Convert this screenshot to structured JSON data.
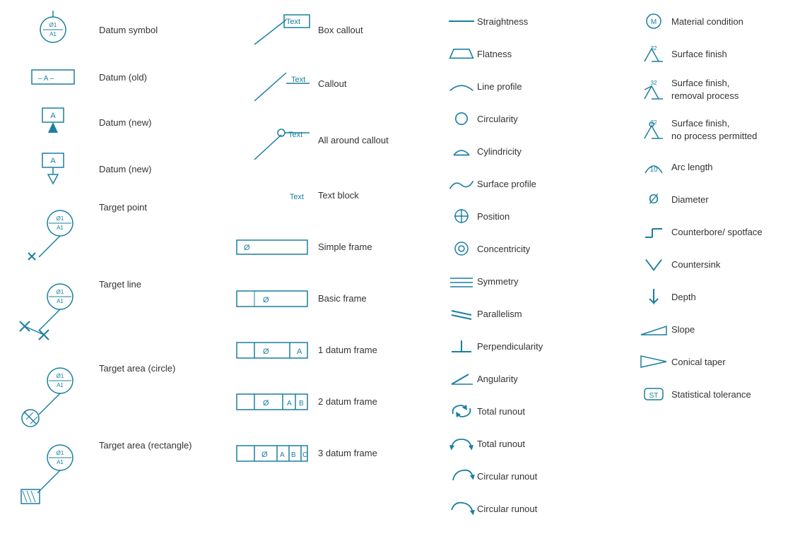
{
  "col1": {
    "items": [
      {
        "id": "datum-symbol",
        "label": "Datum symbol"
      },
      {
        "id": "datum-old",
        "label": "Datum (old)"
      },
      {
        "id": "datum-new-1",
        "label": "Datum (new)"
      },
      {
        "id": "datum-new-2",
        "label": "Datum (new)"
      },
      {
        "id": "target-point",
        "label": "Target point"
      },
      {
        "id": "target-line",
        "label": "Target line"
      },
      {
        "id": "target-area-circle",
        "label": "Target area (circle)"
      },
      {
        "id": "target-area-rect",
        "label": "Target area (rectangle)"
      }
    ]
  },
  "col2": {
    "items": [
      {
        "id": "box-callout",
        "label": "Box callout"
      },
      {
        "id": "callout",
        "label": "Callout"
      },
      {
        "id": "all-around-callout",
        "label": "All around callout"
      },
      {
        "id": "text-block",
        "label": "Text block"
      },
      {
        "id": "simple-frame",
        "label": "Simple frame"
      },
      {
        "id": "basic-frame",
        "label": "Basic frame"
      },
      {
        "id": "1-datum-frame",
        "label": "1 datum frame"
      },
      {
        "id": "2-datum-frame",
        "label": "2 datum frame"
      },
      {
        "id": "3-datum-frame",
        "label": "3 datum frame"
      }
    ]
  },
  "col3": {
    "items": [
      {
        "id": "straightness",
        "label": "Straightness"
      },
      {
        "id": "flatness",
        "label": "Flatness"
      },
      {
        "id": "line-profile",
        "label": "Line profile"
      },
      {
        "id": "circularity",
        "label": "Circularity"
      },
      {
        "id": "cylindricity",
        "label": "Cylindricity"
      },
      {
        "id": "surface-profile",
        "label": "Surface profile"
      },
      {
        "id": "position",
        "label": "Position"
      },
      {
        "id": "concentricity",
        "label": "Concentricity"
      },
      {
        "id": "symmetry",
        "label": "Symmetry"
      },
      {
        "id": "parallelism",
        "label": "Parallelism"
      },
      {
        "id": "perpendicularity",
        "label": "Perpendicularity"
      },
      {
        "id": "angularity",
        "label": "Angularity"
      },
      {
        "id": "total-runout",
        "label": "Total runout"
      },
      {
        "id": "total-runout-2",
        "label": "Total runout"
      },
      {
        "id": "circular-runout",
        "label": "Circular runout"
      },
      {
        "id": "circular-runout-2",
        "label": "Circular runout"
      }
    ]
  },
  "col4": {
    "items": [
      {
        "id": "material-condition",
        "label": "Material condition"
      },
      {
        "id": "surface-finish",
        "label": "Surface finish"
      },
      {
        "id": "surface-finish-removal",
        "label": "Surface finish,\nremoval process"
      },
      {
        "id": "surface-finish-no-process",
        "label": "Surface finish,\nno process permitted"
      },
      {
        "id": "arc-length",
        "label": "Arc length"
      },
      {
        "id": "diameter",
        "label": "Diameter"
      },
      {
        "id": "counterbore",
        "label": "Counterbore/ spotface"
      },
      {
        "id": "countersink",
        "label": "Countersink"
      },
      {
        "id": "depth",
        "label": "Depth"
      },
      {
        "id": "slope",
        "label": "Slope"
      },
      {
        "id": "conical-taper",
        "label": "Conical taper"
      },
      {
        "id": "statistical-tolerance",
        "label": "Statistical tolerance"
      }
    ]
  }
}
